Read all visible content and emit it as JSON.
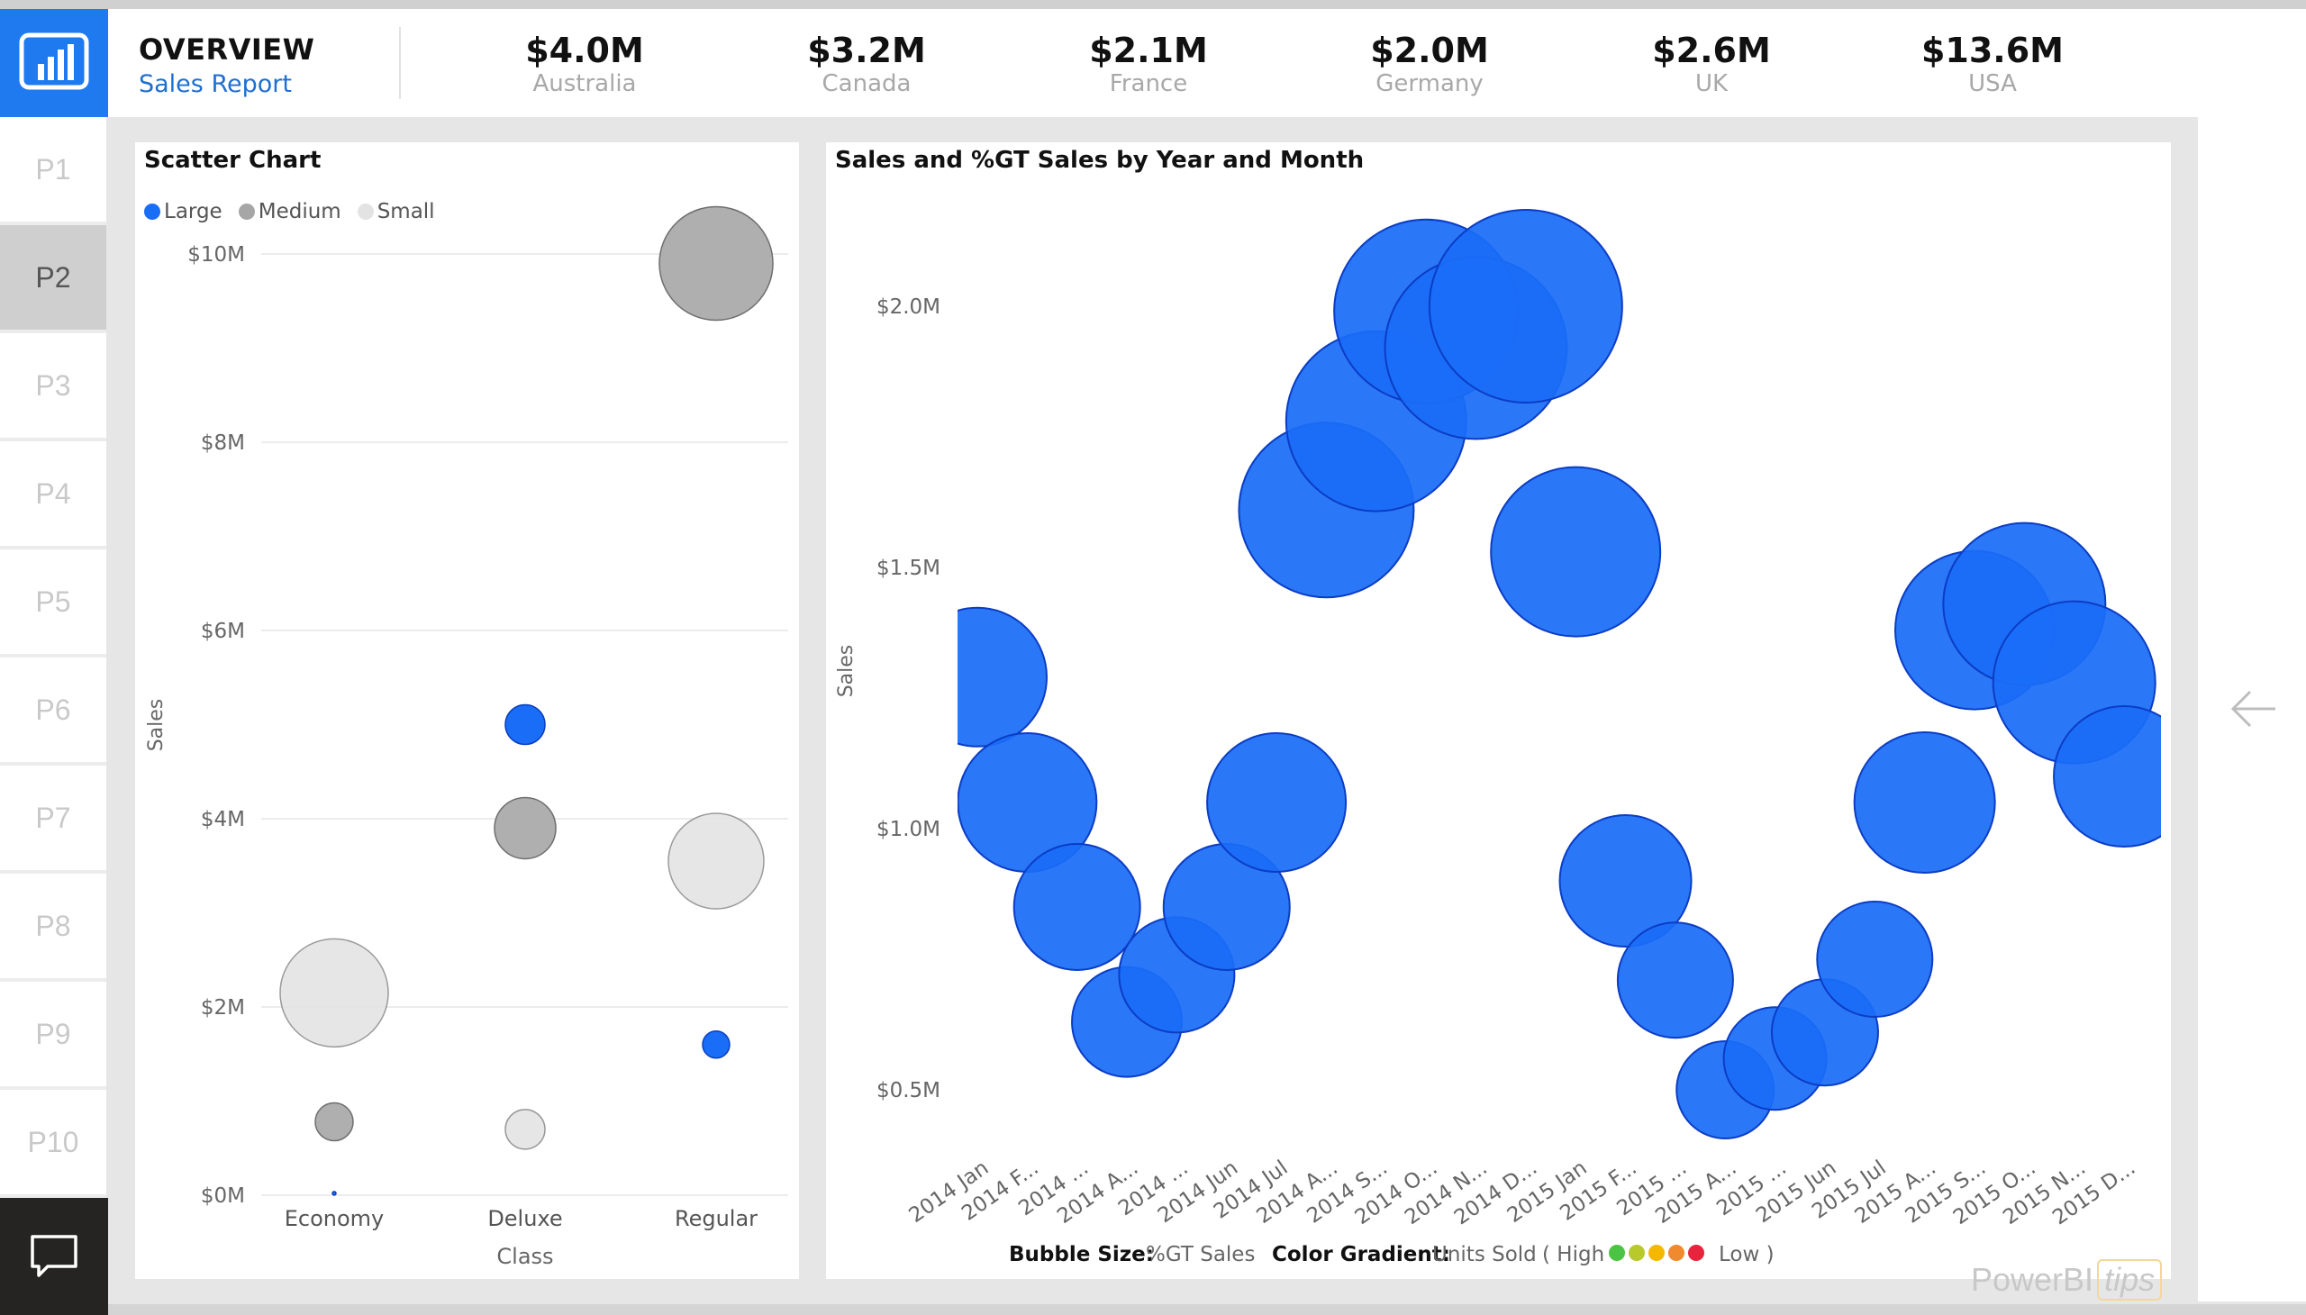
{
  "header": {
    "title": "OVERVIEW",
    "subtitle": "Sales Report",
    "kpis": [
      {
        "value": "$4.0M",
        "label": "Australia"
      },
      {
        "value": "$3.2M",
        "label": "Canada"
      },
      {
        "value": "$2.1M",
        "label": "France"
      },
      {
        "value": "$2.0M",
        "label": "Germany"
      },
      {
        "value": "$2.6M",
        "label": "UK"
      },
      {
        "value": "$13.6M",
        "label": "USA"
      }
    ]
  },
  "sidebar": {
    "pages": [
      "P1",
      "P2",
      "P3",
      "P4",
      "P5",
      "P6",
      "P7",
      "P8",
      "P9",
      "P10"
    ],
    "active": "P2"
  },
  "icons": {
    "logo": "powerbi-logo-icon",
    "chat": "chat-icon",
    "back": "arrow-left-icon"
  },
  "colors": {
    "accent": "#1f7af0",
    "bubble": "#1a6df7",
    "medium": "#a6a6a6",
    "small": "#e3e3e3",
    "dark": "#252423"
  },
  "watermark": {
    "brand": "PowerBI",
    "tips": "tips"
  },
  "chart_data": [
    {
      "type": "scatter",
      "title": "Scatter Chart",
      "xlabel": "Class",
      "ylabel": "Sales",
      "categories": [
        "Economy",
        "Deluxe",
        "Regular"
      ],
      "ylim": [
        0,
        10000000
      ],
      "yticks": [
        "$0M",
        "$2M",
        "$4M",
        "$6M",
        "$8M",
        "$10M"
      ],
      "legend": [
        "Large",
        "Medium",
        "Small"
      ],
      "series": [
        {
          "name": "Large",
          "color": "#1a6df7",
          "points": [
            {
              "x": "Economy",
              "y": 20000,
              "size": 2
            },
            {
              "x": "Deluxe",
              "y": 5000000,
              "size": 22
            },
            {
              "x": "Regular",
              "y": 1600000,
              "size": 15
            }
          ]
        },
        {
          "name": "Medium",
          "color": "#a6a6a6",
          "points": [
            {
              "x": "Economy",
              "y": 780000,
              "size": 21
            },
            {
              "x": "Deluxe",
              "y": 3900000,
              "size": 34
            },
            {
              "x": "Regular",
              "y": 9900000,
              "size": 63
            }
          ]
        },
        {
          "name": "Small",
          "color": "#e3e3e3",
          "points": [
            {
              "x": "Economy",
              "y": 2150000,
              "size": 60
            },
            {
              "x": "Deluxe",
              "y": 700000,
              "size": 22
            },
            {
              "x": "Regular",
              "y": 3550000,
              "size": 53
            }
          ]
        }
      ]
    },
    {
      "type": "scatter",
      "title": "Sales and %GT Sales by Year and Month",
      "ylabel": "Sales",
      "xlabel": "",
      "ylim": [
        0.3,
        2.2
      ],
      "yunit": "M",
      "yticks": [
        "$0.5M",
        "$1.0M",
        "$1.5M",
        "$2.0M"
      ],
      "categories": [
        "2014 Jan",
        "2014 F...",
        "2014 ...",
        "2014 A...",
        "2014 ...",
        "2014 Jun",
        "2014 Jul",
        "2014 A...",
        "2014 S...",
        "2014 O...",
        "2014 N...",
        "2014 D...",
        "2015 Jan",
        "2015 F...",
        "2015 ...",
        "2015 A...",
        "2015 ...",
        "2015 Jun",
        "2015 Jul",
        "2015 A...",
        "2015 S...",
        "2015 O...",
        "2015 N...",
        "2015 D..."
      ],
      "values": [
        1.29,
        1.05,
        0.85,
        0.63,
        0.72,
        0.85,
        1.05,
        1.61,
        1.78,
        1.99,
        1.92,
        2.0,
        1.53,
        0.9,
        0.71,
        0.5,
        0.56,
        0.61,
        0.75,
        1.05,
        1.38,
        1.43,
        1.28,
        1.1
      ],
      "bubble_size": [
        77,
        77,
        70,
        61,
        64,
        70,
        77,
        97,
        100,
        102,
        101,
        107,
        94,
        73,
        64,
        54,
        57,
        59,
        64,
        78,
        88,
        90,
        90,
        78
      ],
      "bubble_size_label": "Bubble Size:",
      "bubble_size_field": "%GT Sales",
      "color_gradient_label": "Color Gradient:",
      "color_gradient_field": "Units Sold",
      "gradient_high": "( High",
      "gradient_low": "Low )",
      "gradient_colors": [
        "#4cc443",
        "#b8c92b",
        "#f5b800",
        "#f08a2c",
        "#e8243c"
      ]
    }
  ]
}
